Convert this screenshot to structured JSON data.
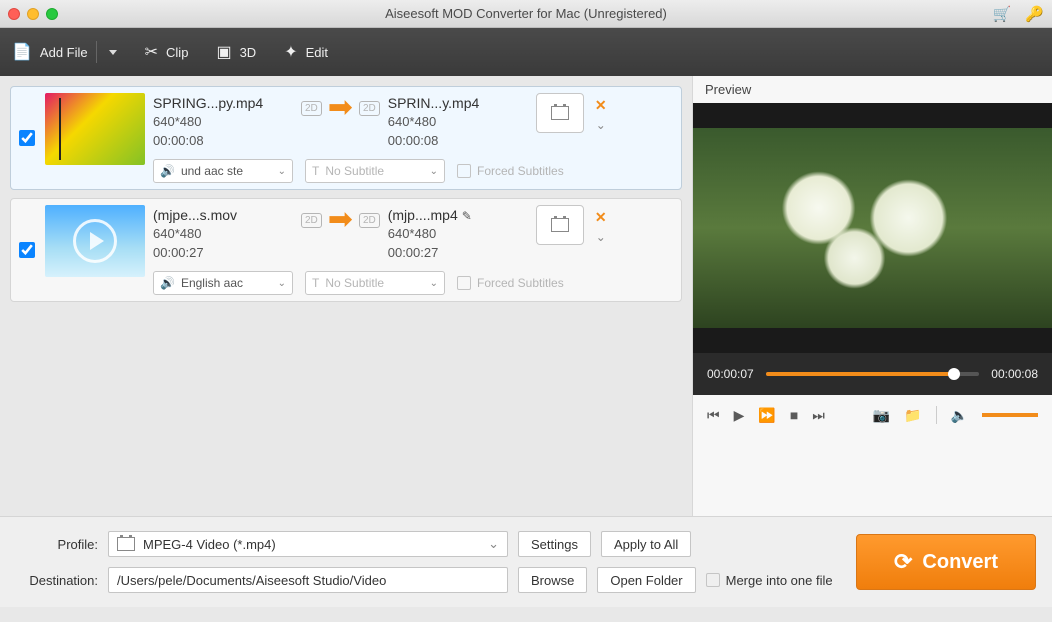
{
  "window": {
    "title": "Aiseesoft MOD Converter for Mac (Unregistered)"
  },
  "toolbar": {
    "addFile": "Add File",
    "clip": "Clip",
    "threeD": "3D",
    "edit": "Edit"
  },
  "items": [
    {
      "src": {
        "name": "SPRING...py.mp4",
        "dim": "640*480",
        "dur": "00:00:08"
      },
      "dst": {
        "name": "SPRIN...y.mp4",
        "dim": "640*480",
        "dur": "00:00:08"
      },
      "audio": "und aac ste",
      "subtitle": "No Subtitle",
      "forced": "Forced Subtitles"
    },
    {
      "src": {
        "name": "(mjpe...s.mov",
        "dim": "640*480",
        "dur": "00:00:27"
      },
      "dst": {
        "name": "(mjp....mp4",
        "dim": "640*480",
        "dur": "00:00:27"
      },
      "audio": "English aac",
      "subtitle": "No Subtitle",
      "forced": "Forced Subtitles"
    }
  ],
  "preview": {
    "label": "Preview",
    "current": "00:00:07",
    "total": "00:00:08"
  },
  "bottom": {
    "profileLabel": "Profile:",
    "profileValue": "MPEG-4 Video (*.mp4)",
    "settings": "Settings",
    "applyAll": "Apply to All",
    "destLabel": "Destination:",
    "destValue": "/Users/pele/Documents/Aiseesoft Studio/Video",
    "browse": "Browse",
    "openFolder": "Open Folder",
    "merge": "Merge into one file",
    "convert": "Convert"
  }
}
